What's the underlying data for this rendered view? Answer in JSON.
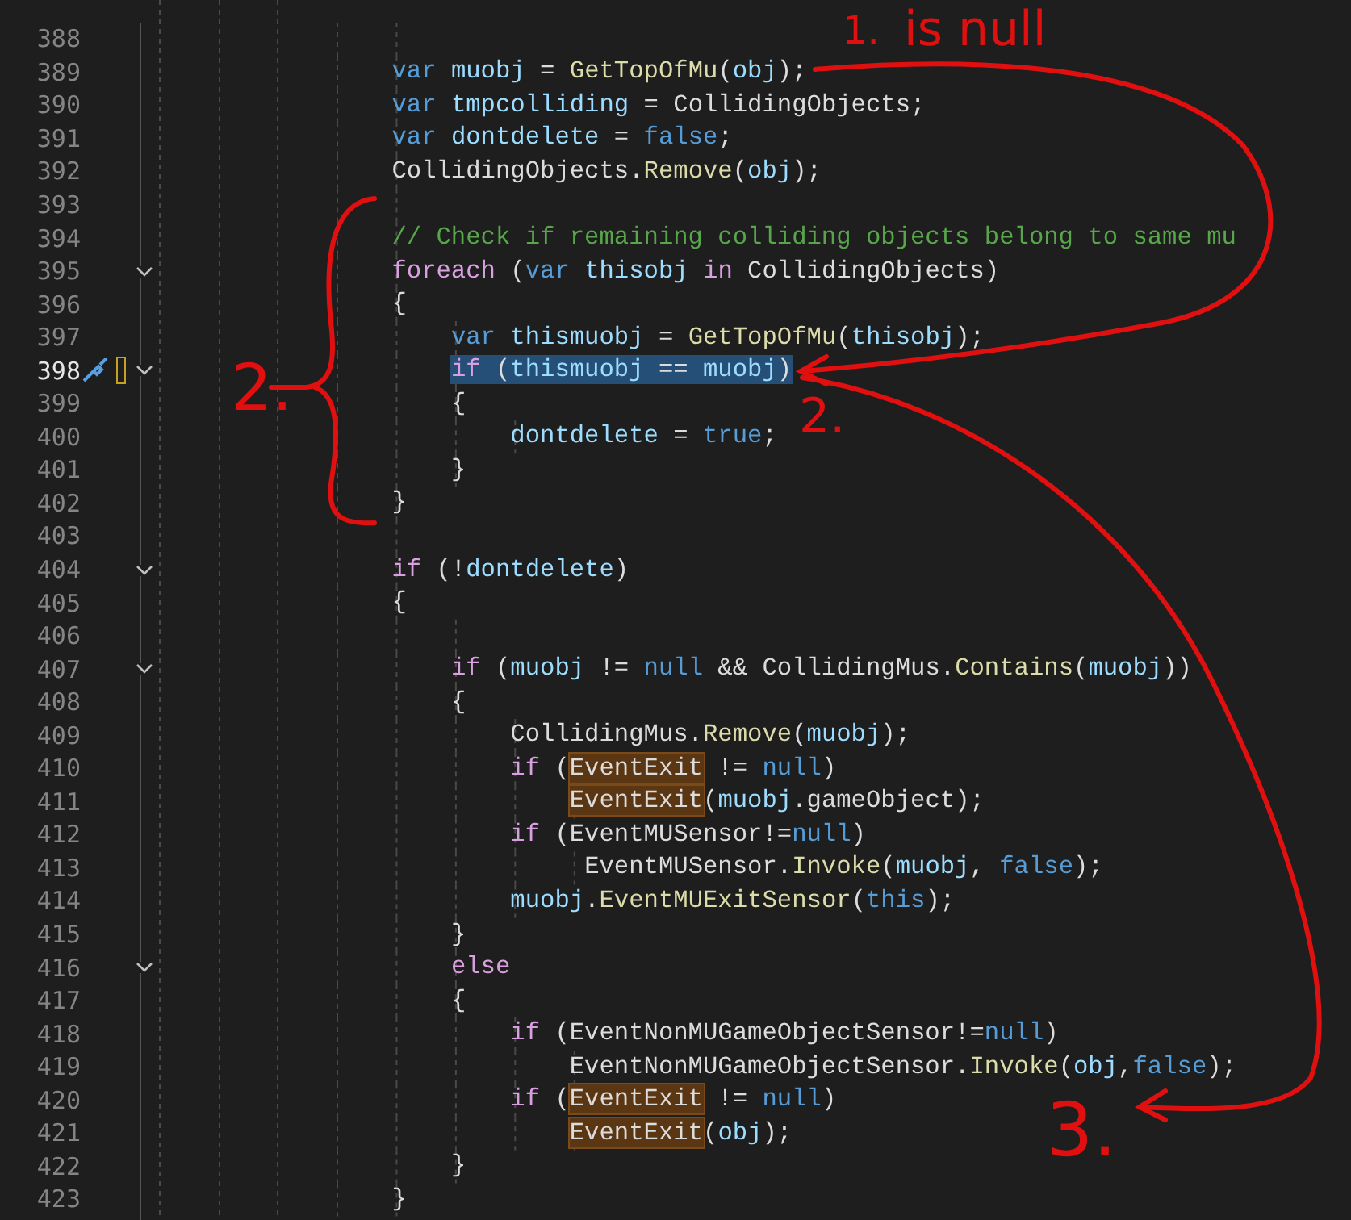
{
  "editor": {
    "lines": [
      {
        "number": "388",
        "selected": false,
        "fold": false
      },
      {
        "number": "389",
        "selected": false,
        "fold": false,
        "tokens": [
          {
            "text": "    var",
            "kind": "kw"
          },
          {
            "text": " muobj",
            "kind": "local"
          },
          {
            "text": " = ",
            "kind": "plain"
          },
          {
            "text": "GetTopOfMu",
            "kind": "method"
          },
          {
            "text": "(",
            "kind": "plain"
          },
          {
            "text": "obj",
            "kind": "local"
          },
          {
            "text": ");",
            "kind": "plain"
          }
        ]
      },
      {
        "number": "390",
        "selected": false,
        "fold": false,
        "tokens": [
          {
            "text": "    var",
            "kind": "kw"
          },
          {
            "text": " tmpcolliding",
            "kind": "local"
          },
          {
            "text": " = CollidingObjects;",
            "kind": "plain"
          }
        ]
      },
      {
        "number": "391",
        "selected": false,
        "fold": false,
        "tokens": [
          {
            "text": "    var",
            "kind": "kw"
          },
          {
            "text": " dontdelete",
            "kind": "local"
          },
          {
            "text": " = ",
            "kind": "plain"
          },
          {
            "text": "false",
            "kind": "kw"
          },
          {
            "text": ";",
            "kind": "plain"
          }
        ]
      },
      {
        "number": "392",
        "selected": false,
        "fold": false,
        "tokens": [
          {
            "text": "    CollidingObjects.",
            "kind": "plain"
          },
          {
            "text": "Remove",
            "kind": "method"
          },
          {
            "text": "(",
            "kind": "plain"
          },
          {
            "text": "obj",
            "kind": "local"
          },
          {
            "text": ");",
            "kind": "plain"
          }
        ]
      },
      {
        "number": "393",
        "selected": false,
        "fold": false
      },
      {
        "number": "394",
        "selected": false,
        "fold": false,
        "tokens": [
          {
            "text": "    // Check if remaining colliding objects belong to same mu",
            "kind": "comment"
          }
        ]
      },
      {
        "number": "395",
        "selected": false,
        "fold": true,
        "tokens": [
          {
            "text": "    foreach",
            "kind": "ctl"
          },
          {
            "text": " (",
            "kind": "plain"
          },
          {
            "text": "var",
            "kind": "kw"
          },
          {
            "text": " thisobj ",
            "kind": "local"
          },
          {
            "text": "in",
            "kind": "ctl"
          },
          {
            "text": " CollidingObjects)",
            "kind": "plain"
          }
        ]
      },
      {
        "number": "396",
        "selected": false,
        "fold": false,
        "tokens": [
          {
            "text": "    {",
            "kind": "plain"
          }
        ]
      },
      {
        "number": "397",
        "selected": false,
        "fold": false,
        "tokens": [
          {
            "text": "        var",
            "kind": "kw"
          },
          {
            "text": " thismuobj",
            "kind": "local"
          },
          {
            "text": " = ",
            "kind": "plain"
          },
          {
            "text": "GetTopOfMu",
            "kind": "method"
          },
          {
            "text": "(",
            "kind": "plain"
          },
          {
            "text": "thisobj",
            "kind": "local"
          },
          {
            "text": ");",
            "kind": "plain"
          }
        ]
      },
      {
        "number": "398",
        "selected": true,
        "fold": true,
        "tokens": [
          {
            "text": "        if",
            "kind": "ctl"
          },
          {
            "text": " (",
            "kind": "plain"
          },
          {
            "text": "thismuobj",
            "kind": "local"
          },
          {
            "text": " == ",
            "kind": "plain"
          },
          {
            "text": "muobj",
            "kind": "local"
          },
          {
            "text": ")",
            "kind": "plain"
          }
        ]
      },
      {
        "number": "399",
        "selected": false,
        "fold": false,
        "tokens": [
          {
            "text": "        {",
            "kind": "plain"
          }
        ]
      },
      {
        "number": "400",
        "selected": false,
        "fold": false,
        "tokens": [
          {
            "text": "            dontdelete",
            "kind": "local"
          },
          {
            "text": " = ",
            "kind": "plain"
          },
          {
            "text": "true",
            "kind": "kw"
          },
          {
            "text": ";",
            "kind": "plain"
          }
        ]
      },
      {
        "number": "401",
        "selected": false,
        "fold": false,
        "tokens": [
          {
            "text": "        }",
            "kind": "plain"
          }
        ]
      },
      {
        "number": "402",
        "selected": false,
        "fold": false,
        "tokens": [
          {
            "text": "    }",
            "kind": "plain"
          }
        ]
      },
      {
        "number": "403",
        "selected": false,
        "fold": false
      },
      {
        "number": "404",
        "selected": false,
        "fold": true,
        "tokens": [
          {
            "text": "    if",
            "kind": "ctl"
          },
          {
            "text": " (!",
            "kind": "plain"
          },
          {
            "text": "dontdelete",
            "kind": "local"
          },
          {
            "text": ")",
            "kind": "plain"
          }
        ]
      },
      {
        "number": "405",
        "selected": false,
        "fold": false,
        "tokens": [
          {
            "text": "    {",
            "kind": "plain"
          }
        ]
      },
      {
        "number": "406",
        "selected": false,
        "fold": false
      },
      {
        "number": "407",
        "selected": false,
        "fold": true,
        "tokens": [
          {
            "text": "        if",
            "kind": "ctl"
          },
          {
            "text": " (",
            "kind": "plain"
          },
          {
            "text": "muobj",
            "kind": "local"
          },
          {
            "text": " != ",
            "kind": "plain"
          },
          {
            "text": "null",
            "kind": "kw"
          },
          {
            "text": " && CollidingMus.",
            "kind": "plain"
          },
          {
            "text": "Contains",
            "kind": "method"
          },
          {
            "text": "(",
            "kind": "plain"
          },
          {
            "text": "muobj",
            "kind": "local"
          },
          {
            "text": "))",
            "kind": "plain"
          }
        ]
      },
      {
        "number": "408",
        "selected": false,
        "fold": false,
        "tokens": [
          {
            "text": "        {",
            "kind": "plain"
          }
        ]
      },
      {
        "number": "409",
        "selected": false,
        "fold": false,
        "tokens": [
          {
            "text": "            CollidingMus.",
            "kind": "plain"
          },
          {
            "text": "Remove",
            "kind": "method"
          },
          {
            "text": "(",
            "kind": "plain"
          },
          {
            "text": "muobj",
            "kind": "local"
          },
          {
            "text": ");",
            "kind": "plain"
          }
        ]
      },
      {
        "number": "410",
        "selected": false,
        "fold": false,
        "tokens": [
          {
            "text": "            if",
            "kind": "ctl"
          },
          {
            "text": " (",
            "kind": "plain"
          },
          {
            "text": "EventExit",
            "kind": "hl"
          },
          {
            "text": " != ",
            "kind": "plain"
          },
          {
            "text": "null",
            "kind": "kw"
          },
          {
            "text": ")",
            "kind": "plain"
          }
        ]
      },
      {
        "number": "411",
        "selected": false,
        "fold": false,
        "tokens": [
          {
            "text": "                EventExit",
            "kind": "hl"
          },
          {
            "text": "(",
            "kind": "plain"
          },
          {
            "text": "muobj",
            "kind": "local"
          },
          {
            "text": ".gameObject);",
            "kind": "plain"
          }
        ]
      },
      {
        "number": "412",
        "selected": false,
        "fold": false,
        "tokens": [
          {
            "text": "            if",
            "kind": "ctl"
          },
          {
            "text": " (EventMUSensor!=",
            "kind": "plain"
          },
          {
            "text": "null",
            "kind": "kw"
          },
          {
            "text": ")",
            "kind": "plain"
          }
        ]
      },
      {
        "number": "413",
        "selected": false,
        "fold": false,
        "tokens": [
          {
            "text": "                 EventMUSensor.",
            "kind": "plain"
          },
          {
            "text": "Invoke",
            "kind": "method"
          },
          {
            "text": "(",
            "kind": "plain"
          },
          {
            "text": "muobj",
            "kind": "local"
          },
          {
            "text": ", ",
            "kind": "plain"
          },
          {
            "text": "false",
            "kind": "kw"
          },
          {
            "text": ");",
            "kind": "plain"
          }
        ]
      },
      {
        "number": "414",
        "selected": false,
        "fold": false,
        "tokens": [
          {
            "text": "            muobj",
            "kind": "local"
          },
          {
            "text": ".",
            "kind": "plain"
          },
          {
            "text": "EventMUExitSensor",
            "kind": "method"
          },
          {
            "text": "(",
            "kind": "plain"
          },
          {
            "text": "this",
            "kind": "kw"
          },
          {
            "text": ");",
            "kind": "plain"
          }
        ]
      },
      {
        "number": "415",
        "selected": false,
        "fold": false,
        "tokens": [
          {
            "text": "        }",
            "kind": "plain"
          }
        ]
      },
      {
        "number": "416",
        "selected": false,
        "fold": true,
        "tokens": [
          {
            "text": "        else",
            "kind": "ctl"
          }
        ]
      },
      {
        "number": "417",
        "selected": false,
        "fold": false,
        "tokens": [
          {
            "text": "        {",
            "kind": "plain"
          }
        ]
      },
      {
        "number": "418",
        "selected": false,
        "fold": false,
        "tokens": [
          {
            "text": "            if",
            "kind": "ctl"
          },
          {
            "text": " (EventNonMUGameObjectSensor!=",
            "kind": "plain"
          },
          {
            "text": "null",
            "kind": "kw"
          },
          {
            "text": ")",
            "kind": "plain"
          }
        ]
      },
      {
        "number": "419",
        "selected": false,
        "fold": false,
        "tokens": [
          {
            "text": "                EventNonMUGameObjectSensor.",
            "kind": "plain"
          },
          {
            "text": "Invoke",
            "kind": "method"
          },
          {
            "text": "(",
            "kind": "plain"
          },
          {
            "text": "obj",
            "kind": "local"
          },
          {
            "text": ",",
            "kind": "plain"
          },
          {
            "text": "false",
            "kind": "kw"
          },
          {
            "text": ");",
            "kind": "plain"
          }
        ]
      },
      {
        "number": "420",
        "selected": false,
        "fold": false,
        "tokens": [
          {
            "text": "            if",
            "kind": "ctl"
          },
          {
            "text": " (",
            "kind": "plain"
          },
          {
            "text": "EventExit",
            "kind": "hl"
          },
          {
            "text": " != ",
            "kind": "plain"
          },
          {
            "text": "null",
            "kind": "kw"
          },
          {
            "text": ")",
            "kind": "plain"
          }
        ]
      },
      {
        "number": "421",
        "selected": false,
        "fold": false,
        "tokens": [
          {
            "text": "                EventExit",
            "kind": "hl"
          },
          {
            "text": "(",
            "kind": "plain"
          },
          {
            "text": "obj",
            "kind": "local"
          },
          {
            "text": ");",
            "kind": "plain"
          }
        ]
      },
      {
        "number": "422",
        "selected": false,
        "fold": false,
        "tokens": [
          {
            "text": "        }",
            "kind": "plain"
          }
        ]
      },
      {
        "number": "423",
        "selected": false,
        "fold": false,
        "tokens": [
          {
            "text": "    }",
            "kind": "plain"
          }
        ]
      }
    ]
  },
  "annotations": [
    {
      "text": "1."
    },
    {
      "text": "is null"
    },
    {
      "text": "2."
    },
    {
      "text": "2."
    },
    {
      "text": "3."
    }
  ]
}
